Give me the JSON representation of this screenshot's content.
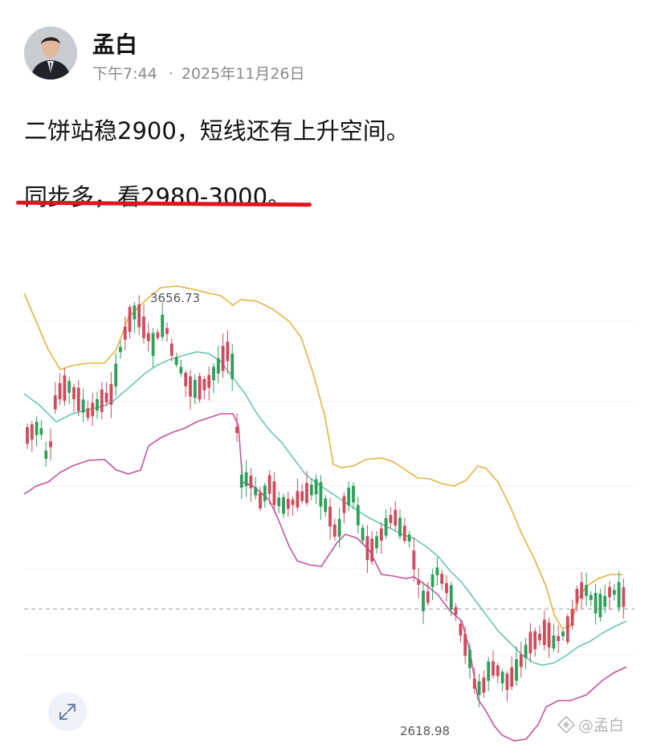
{
  "post": {
    "author": "孟白",
    "time": "下午7:44",
    "separator": "·",
    "date": "2025年11月26日",
    "line1": "二饼站稳2900，短线还有上升空间。",
    "line2": "同步多，看2980-3000。"
  },
  "watermark": {
    "text": "@孟白",
    "icon": "logo-icon"
  },
  "expand": {
    "icon": "expand-icon"
  },
  "colors": {
    "up": "#2e9e5b",
    "down": "#d04a5c",
    "upper_band": "#e3b342",
    "middle_band": "#68c6b4",
    "lower_band": "#c0549c",
    "underline": "#e1141c"
  },
  "chart_data": {
    "type": "candlestick",
    "high_label": "3656.73",
    "low_label": "2618.98",
    "indicators": [
      "upper band",
      "middle band",
      "lower band"
    ],
    "current_price_line": 2900,
    "ylim": [
      2560,
      3720
    ]
  }
}
